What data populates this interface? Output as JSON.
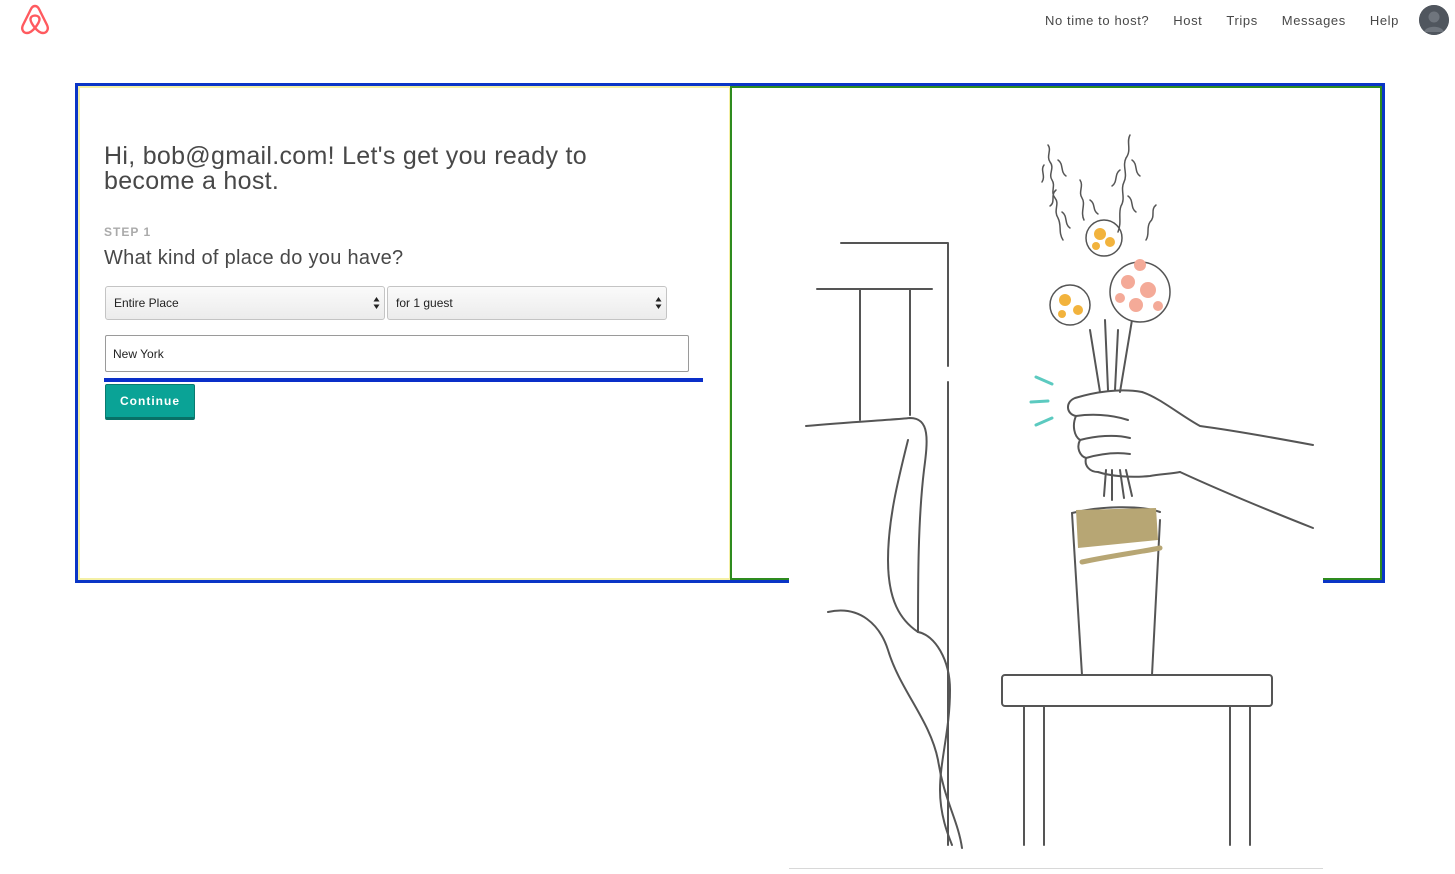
{
  "nav": {
    "links": [
      "No time to host?",
      "Host",
      "Trips",
      "Messages",
      "Help"
    ]
  },
  "icons": {
    "logo": "airbnb-belo-logo",
    "avatar": "user-avatar"
  },
  "colors": {
    "brand": "#ff5a5f",
    "continue_button": "#0aa396",
    "outline_blue": "#0a35c6",
    "outline_green": "#2e8b1f",
    "outline_yellow": "#f4f0a6"
  },
  "onboarding": {
    "headline": "Hi, bob@gmail.com! Let's get you ready to become a host.",
    "step_label": "STEP 1",
    "question": "What kind of place do you have?",
    "place_type": {
      "selected": "Entire Place"
    },
    "guests": {
      "selected": "for 1 guest"
    },
    "city": {
      "value": "New York"
    },
    "continue_label": "Continue"
  }
}
